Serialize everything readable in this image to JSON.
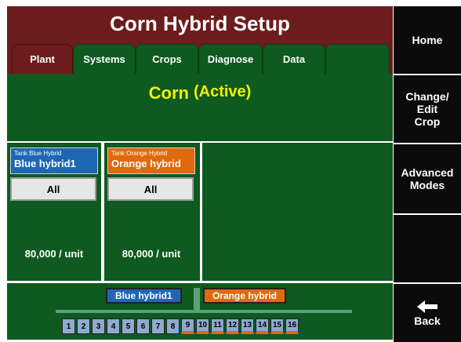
{
  "title": "Corn Hybrid Setup",
  "tabs": [
    {
      "label": "Plant"
    },
    {
      "label": "Systems"
    },
    {
      "label": "Crops"
    },
    {
      "label": "Diagnose"
    },
    {
      "label": "Data"
    }
  ],
  "active_tab": "Plant",
  "crop": {
    "name": "Corn",
    "status": "(Active)"
  },
  "hybrids": [
    {
      "tank_label": "Tank Blue Hybrid",
      "name": "Blue hybrid1",
      "color": "#1f67b5",
      "selector_value": "All",
      "rate": "80,000 / unit"
    },
    {
      "tank_label": "Tank Orange Hybrid",
      "name": "Orange hybrid",
      "color": "#e0690f",
      "selector_value": "All",
      "rate": "80,000 / unit"
    }
  ],
  "planter": {
    "blue_label": "Blue hybrid1",
    "orange_label": "Orange hybrid",
    "rows": [
      "1",
      "2",
      "3",
      "4",
      "5",
      "6",
      "7",
      "8",
      "9",
      "10",
      "11",
      "12",
      "13",
      "14",
      "15",
      "16"
    ]
  },
  "sidebar": {
    "home": "Home",
    "change_edit_crop": "Change/\nEdit\nCrop",
    "advanced_modes": "Advanced\nModes",
    "back": "Back"
  },
  "colors": {
    "header_bg": "#6c1c1c",
    "panel_green": "#0e5a20",
    "crop_text": "#f3f300",
    "blue": "#1f67b5",
    "orange": "#e0690f",
    "sidebar_bg": "#0b0b0b"
  }
}
